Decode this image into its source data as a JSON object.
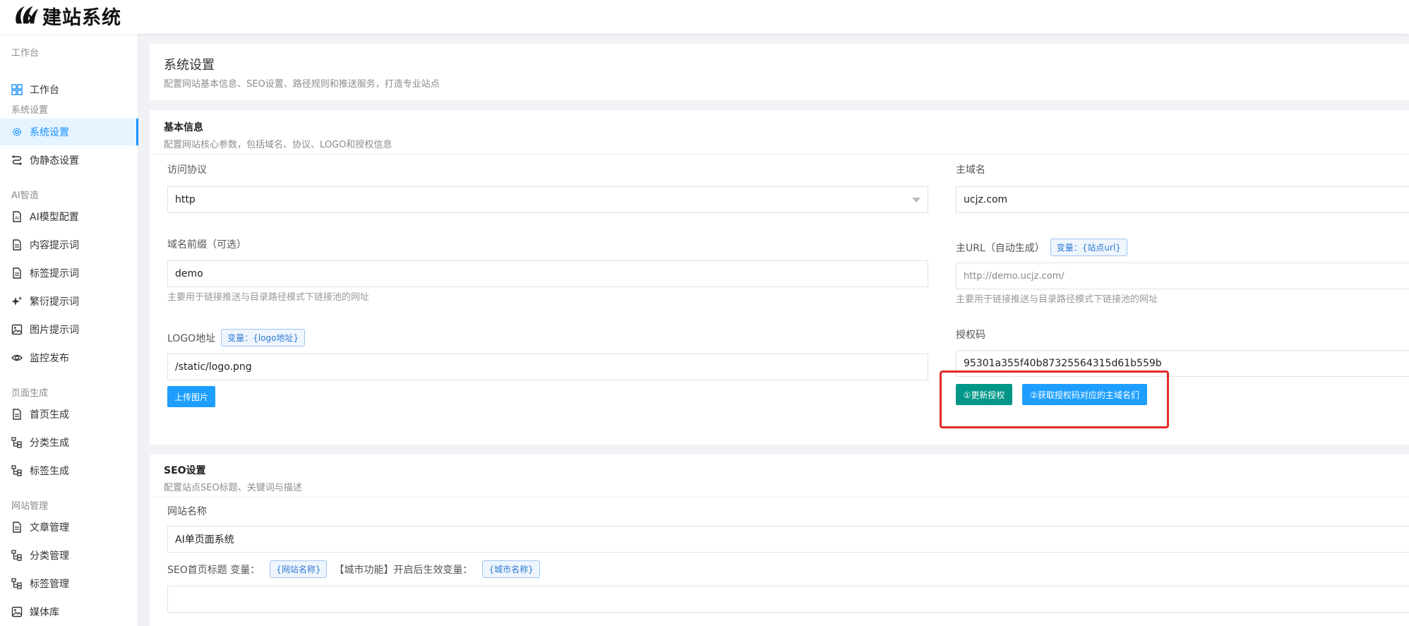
{
  "app": {
    "logo_text": "建站系统"
  },
  "sidebar": {
    "groups": [
      "工作台",
      "系统设置",
      "AI智造",
      "页面生成",
      "网站管理"
    ],
    "items": [
      {
        "label": "工作台",
        "icon": "dashboard-icon"
      },
      {
        "label": "系统设置",
        "icon": "gear-icon"
      },
      {
        "label": "伪静态设置",
        "icon": "route-icon"
      },
      {
        "label": "AI模型配置",
        "icon": "ai-doc-icon"
      },
      {
        "label": "内容提示词",
        "icon": "document-icon"
      },
      {
        "label": "标签提示词",
        "icon": "document-icon"
      },
      {
        "label": "繁衍提示词",
        "icon": "sparkle-icon"
      },
      {
        "label": "图片提示词",
        "icon": "image-icon"
      },
      {
        "label": "监控发布",
        "icon": "eye-icon"
      },
      {
        "label": "首页生成",
        "icon": "document-icon"
      },
      {
        "label": "分类生成",
        "icon": "tree-icon"
      },
      {
        "label": "标签生成",
        "icon": "tree-icon"
      },
      {
        "label": "文章管理",
        "icon": "document-icon"
      },
      {
        "label": "分类管理",
        "icon": "tree-icon"
      },
      {
        "label": "标签管理",
        "icon": "tree-icon"
      },
      {
        "label": "媒体库",
        "icon": "image-icon"
      }
    ],
    "active_index": 1
  },
  "page": {
    "title": "系统设置",
    "subtitle": "配置网站基本信息、SEO设置、路径规则和推送服务，打造专业站点"
  },
  "basic": {
    "title": "基本信息",
    "subtitle": "配置网站核心参数，包括域名、协议、LOGO和授权信息",
    "protocol_label": "访问协议",
    "protocol_value": "http",
    "domain_label": "主域名",
    "domain_value": "ucjz.com",
    "prefix_label": "域名前缀（可选）",
    "prefix_value": "demo",
    "prefix_hint": "主要用于链接推送与目录路径模式下链接池的网址",
    "url_label": "主URL（自动生成）",
    "url_tag": "变量：{站点url}",
    "url_value": "http://demo.ucjz.com/",
    "url_hint": "主要用于链接推送与目录路径模式下链接池的网址",
    "logo_label": "LOGO地址",
    "logo_tag": "变量：{logo地址}",
    "logo_value": "/static/logo.png",
    "upload_button": "上传图片",
    "license_label": "授权码",
    "license_value": "95301a355f40b87325564315d61b559b",
    "update_button": "①更新授权",
    "fetch_button": "②获取授权码对应的主域名们"
  },
  "seo": {
    "title": "SEO设置",
    "subtitle": "配置站点SEO标题、关键词与描述",
    "site_name_label": "网站名称",
    "site_name_value": "AI单页面系统",
    "home_title_label": "SEO首页标题 变量：",
    "home_title_tag": "{网站名称}",
    "city_note": "【城市功能】开启后生效变量：",
    "city_tag": "{城市名称}"
  },
  "colors": {
    "accent": "#1890ff",
    "button_blue": "#1e9fff",
    "button_green": "#009688",
    "highlight_red": "#e02a2a"
  }
}
